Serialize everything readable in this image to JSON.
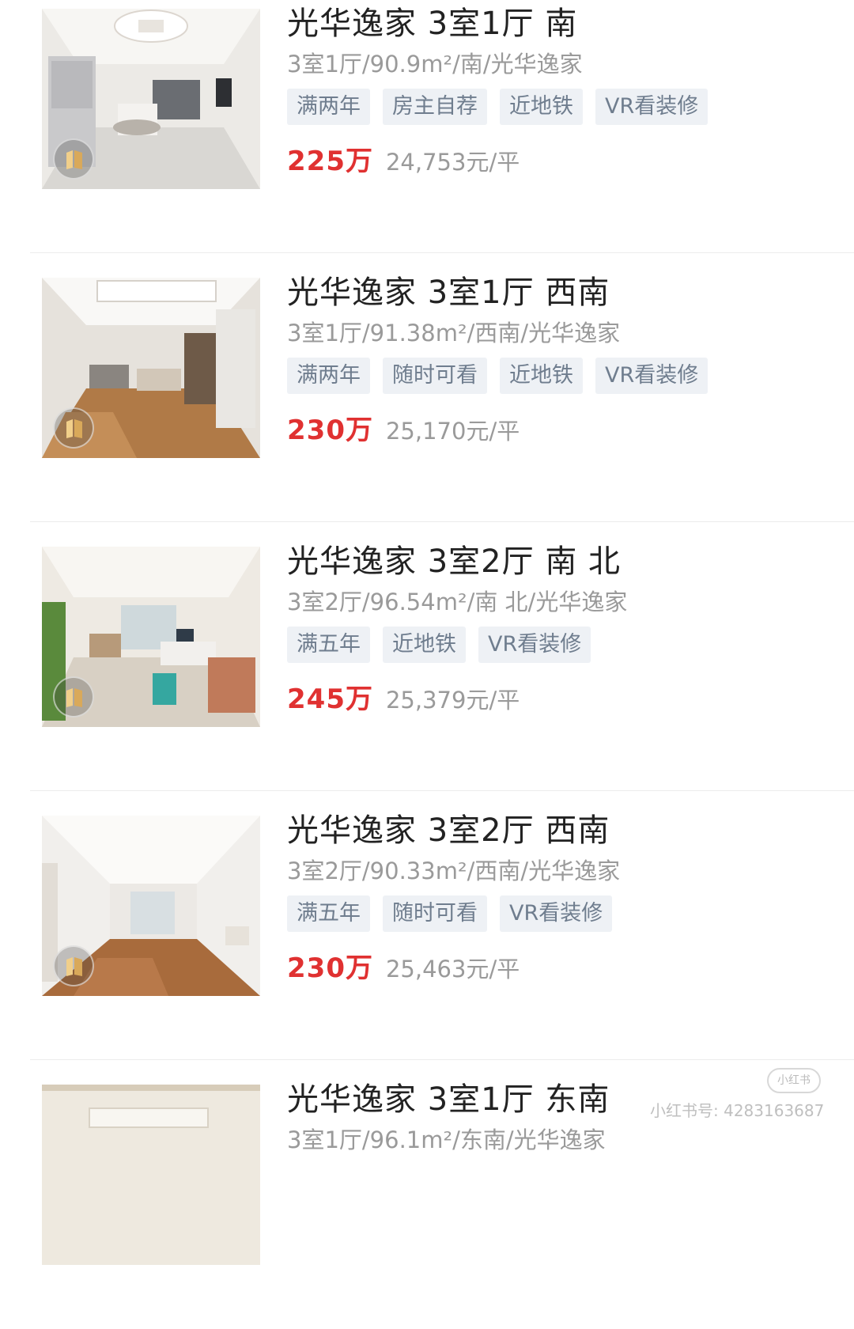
{
  "listings": [
    {
      "title": "光华逸家  3室1厅  南",
      "meta": "3室1厅/90.9m²/南/光华逸家",
      "tags": [
        "满两年",
        "房主自荐",
        "近地铁",
        "VR看装修"
      ],
      "price": "225万",
      "unit_price": "24,753元/平",
      "photo_icon": "living-room-photo",
      "badge_icon": "vr-icon"
    },
    {
      "title": "光华逸家  3室1厅  西南",
      "meta": "3室1厅/91.38m²/西南/光华逸家",
      "tags": [
        "满两年",
        "随时可看",
        "近地铁",
        "VR看装修"
      ],
      "price": "230万",
      "unit_price": "25,170元/平",
      "photo_icon": "living-room-photo",
      "badge_icon": "vr-icon"
    },
    {
      "title": "光华逸家  3室2厅  南 北",
      "meta": "3室2厅/96.54m²/南 北/光华逸家",
      "tags": [
        "满五年",
        "近地铁",
        "VR看装修"
      ],
      "price": "245万",
      "unit_price": "25,379元/平",
      "photo_icon": "office-room-photo",
      "badge_icon": "vr-icon"
    },
    {
      "title": "光华逸家  3室2厅  西南",
      "meta": "3室2厅/90.33m²/西南/光华逸家",
      "tags": [
        "满五年",
        "随时可看",
        "VR看装修"
      ],
      "price": "230万",
      "unit_price": "25,463元/平",
      "photo_icon": "empty-room-photo",
      "badge_icon": "vr-icon"
    },
    {
      "title": "光华逸家  3室1厅  东南",
      "meta": "3室1厅/96.1m²/东南/光华逸家",
      "tags": [],
      "price": "",
      "unit_price": "",
      "photo_icon": "room-photo",
      "badge_icon": "vr-icon"
    }
  ],
  "watermark": {
    "logo_text": "小红书",
    "text": "小红书号: 4283163687"
  },
  "colors": {
    "price": "#e03131",
    "tag_bg": "#eef1f5",
    "tag_text": "#6f7d8e",
    "meta_text": "#9a9a9a",
    "title_text": "#222222"
  }
}
